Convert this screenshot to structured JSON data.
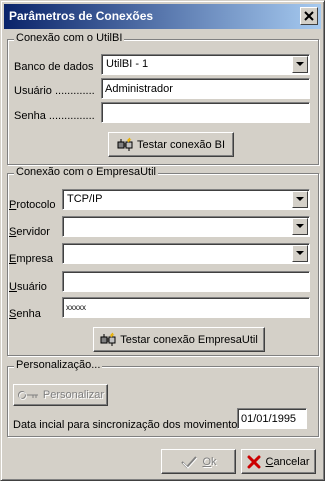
{
  "window": {
    "title": "Parâmetros de Conexões"
  },
  "utilbi": {
    "legend": "Conexão com o UtilBI",
    "banco_label": "Banco de dados",
    "banco_value": "UtilBI - 1",
    "usuario_label": "Usuário .............",
    "usuario_value": "Administrador",
    "senha_label": "Senha ...............",
    "senha_value": "",
    "test_button": "Testar conexão BI"
  },
  "empresa": {
    "legend": "Conexão com o EmpresaUtil",
    "protocolo_hotkey": "P",
    "protocolo_rest": "rotocolo",
    "protocolo_value": "TCP/IP",
    "servidor_hotkey": "S",
    "servidor_rest": "ervidor",
    "servidor_value": "",
    "empresa_hotkey": "E",
    "empresa_rest": "mpresa",
    "empresa_value": "",
    "usuario_hotkey": "U",
    "usuario_rest": "suário",
    "usuario_value": "",
    "senha_hotkey": "S",
    "senha_rest": "enha",
    "senha_value": "xxxxx",
    "test_button": "Testar conexão EmpresaUtil"
  },
  "personalizacao": {
    "legend": "Personalização...",
    "button": "Personalizar",
    "date_label": "Data incial para sincronização dos movimentos",
    "date_value": "01/01/1995"
  },
  "footer": {
    "ok_hotkey": "O",
    "ok_rest": "k",
    "cancel_hotkey": "C",
    "cancel_rest": "ancelar"
  },
  "icons": {
    "close": "close-icon",
    "test": "plug-connection-icon",
    "personalizar": "key-icon",
    "ok": "checkmark-icon",
    "cancel": "red-x-icon"
  }
}
